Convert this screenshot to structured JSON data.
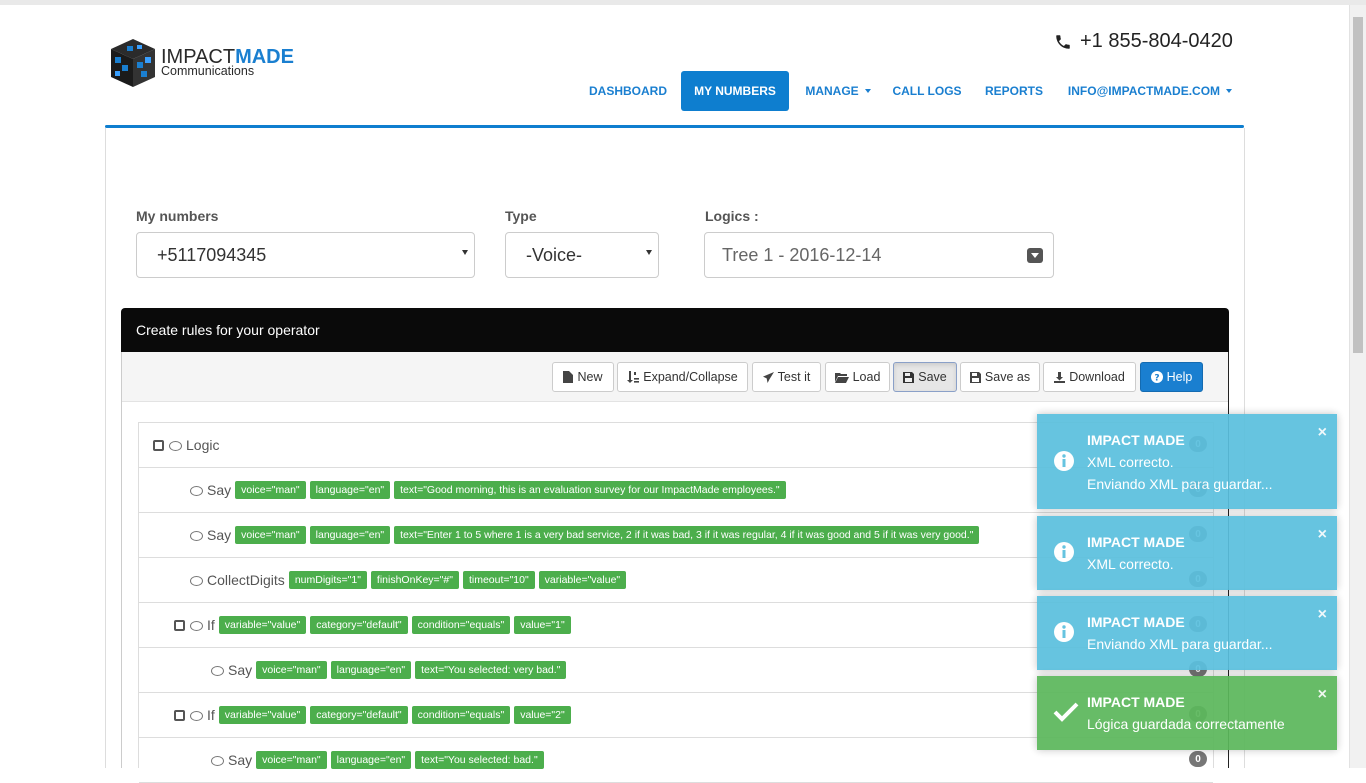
{
  "brand": {
    "name_light": "IMPACT",
    "name_bold": "MADE",
    "sub": "Communications"
  },
  "header": {
    "phone": "+1 855-804-0420"
  },
  "nav": {
    "dashboard": "DASHBOARD",
    "my_numbers": "MY NUMBERS",
    "manage": "MANAGE",
    "call_logs": "CALL LOGS",
    "reports": "REPORTS",
    "account": "INFO@IMPACTMADE.COM"
  },
  "filters": {
    "numbers_label": "My numbers",
    "numbers_value": "+5117094345",
    "type_label": "Type",
    "type_value": "-Voice-",
    "logics_label": "Logics :",
    "logics_value": "Tree 1 - 2016-12-14"
  },
  "rules": {
    "title": "Create rules for your operator",
    "toolbar": {
      "new": "New",
      "expand": "Expand/Collapse",
      "test": "Test it",
      "load": "Load",
      "save": "Save",
      "save_as": "Save as",
      "download": "Download",
      "help": "Help"
    },
    "tree": [
      {
        "name": "Logic",
        "tags": [],
        "badge": "0"
      },
      {
        "name": "Say",
        "tags": [
          "voice=\"man\"",
          "language=\"en\"",
          "text=\"Good morning, this is an evaluation survey for our ImpactMade employees.\""
        ],
        "badge": "0"
      },
      {
        "name": "Say",
        "tags": [
          "voice=\"man\"",
          "language=\"en\"",
          "text=\"Enter 1 to 5 where 1 is a very bad service, 2 if it was bad, 3 if it was regular, 4 if it was good and 5 if it was very good.\""
        ],
        "badge": "0"
      },
      {
        "name": "CollectDigits",
        "tags": [
          "numDigits=\"1\"",
          "finishOnKey=\"#\"",
          "timeout=\"10\"",
          "variable=\"value\""
        ],
        "badge": "0"
      },
      {
        "name": "If",
        "tags": [
          "variable=\"value\"",
          "category=\"default\"",
          "condition=\"equals\"",
          "value=\"1\""
        ],
        "badge": "0"
      },
      {
        "name": "Say",
        "tags": [
          "voice=\"man\"",
          "language=\"en\"",
          "text=\"You selected: very bad.\""
        ],
        "badge": "0"
      },
      {
        "name": "If",
        "tags": [
          "variable=\"value\"",
          "category=\"default\"",
          "condition=\"equals\"",
          "value=\"2\""
        ],
        "badge": "0"
      },
      {
        "name": "Say",
        "tags": [
          "voice=\"man\"",
          "language=\"en\"",
          "text=\"You selected: bad.\""
        ],
        "badge": "0"
      }
    ]
  },
  "toasts": [
    {
      "title": "IMPACT MADE",
      "line1": "XML correcto.",
      "line2": "Enviando XML para guardar...",
      "close": "×",
      "icon": "info-icon"
    },
    {
      "title": "IMPACT MADE",
      "line1": "XML correcto.",
      "line2": "",
      "close": "×",
      "icon": "info-icon"
    },
    {
      "title": "IMPACT MADE",
      "line1": "Enviando XML para guardar...",
      "line2": "",
      "close": "×",
      "icon": "info-icon"
    },
    {
      "title": "IMPACT MADE",
      "line1": "Lógica guardada correctamente",
      "line2": "",
      "close": "×",
      "icon": "check-icon"
    }
  ],
  "colors": {
    "primary": "#0e7ecf",
    "tag": "#4cae4c",
    "info": "#5bc0de",
    "success": "#5cb85c",
    "header_bar": "#0a0a0a"
  }
}
